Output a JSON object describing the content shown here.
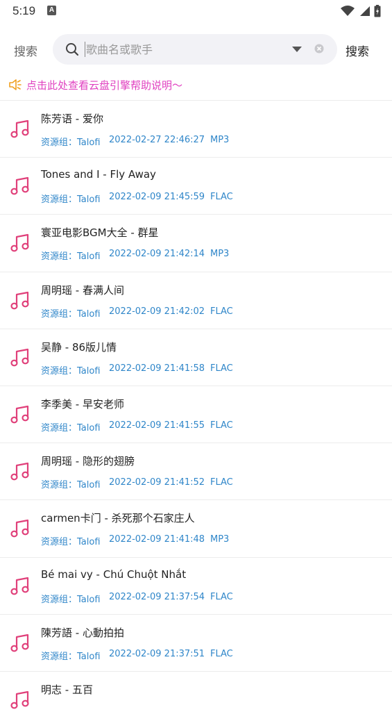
{
  "status": {
    "time": "5:19",
    "a_icon": "A"
  },
  "search": {
    "label": "搜索",
    "placeholder": "歌曲名或歌手",
    "button_label": "搜索"
  },
  "notice": {
    "text": "点击此处查看云盘引擎帮助说明～"
  },
  "songs": [
    {
      "title": "陈芳语 - 爱你",
      "group": "资源组：Talofi",
      "date": "2022-02-27 22:46:27",
      "format": "MP3"
    },
    {
      "title": "Tones and I - Fly Away",
      "group": "资源组：Talofi",
      "date": "2022-02-09 21:45:59",
      "format": "FLAC"
    },
    {
      "title": "寰亚电影BGM大全 - 群星",
      "group": "资源组：Talofi",
      "date": "2022-02-09 21:42:14",
      "format": "MP3"
    },
    {
      "title": "周明瑶 - 春满人间",
      "group": "资源组：Talofi",
      "date": "2022-02-09 21:42:02",
      "format": "FLAC"
    },
    {
      "title": "吴静 - 86版儿情",
      "group": "资源组：Talofi",
      "date": "2022-02-09 21:41:58",
      "format": "FLAC"
    },
    {
      "title": "李季美 - 早安老师",
      "group": "资源组：Talofi",
      "date": "2022-02-09 21:41:55",
      "format": "FLAC"
    },
    {
      "title": "周明瑶 - 隐形的翅膀",
      "group": "资源组：Talofi",
      "date": "2022-02-09 21:41:52",
      "format": "FLAC"
    },
    {
      "title": "carmen卡门 - 杀死那个石家庄人",
      "group": "资源组：Talofi",
      "date": "2022-02-09 21:41:48",
      "format": "MP3"
    },
    {
      "title": "Bé mai vy - Chú Chuột Nhắt",
      "group": "资源组：Talofi",
      "date": "2022-02-09 21:37:54",
      "format": "FLAC"
    },
    {
      "title": "陳芳語 - 心動拍拍",
      "group": "资源组：Talofi",
      "date": "2022-02-09 21:37:51",
      "format": "FLAC"
    },
    {
      "title": "明志 - 五百",
      "group": "",
      "date": "",
      "format": ""
    }
  ],
  "colors": {
    "accent_pink": "#e0407a",
    "notice_magenta": "#e040c0",
    "meta_blue": "#2f86c9",
    "notice_icon_orange": "#f0a020"
  }
}
